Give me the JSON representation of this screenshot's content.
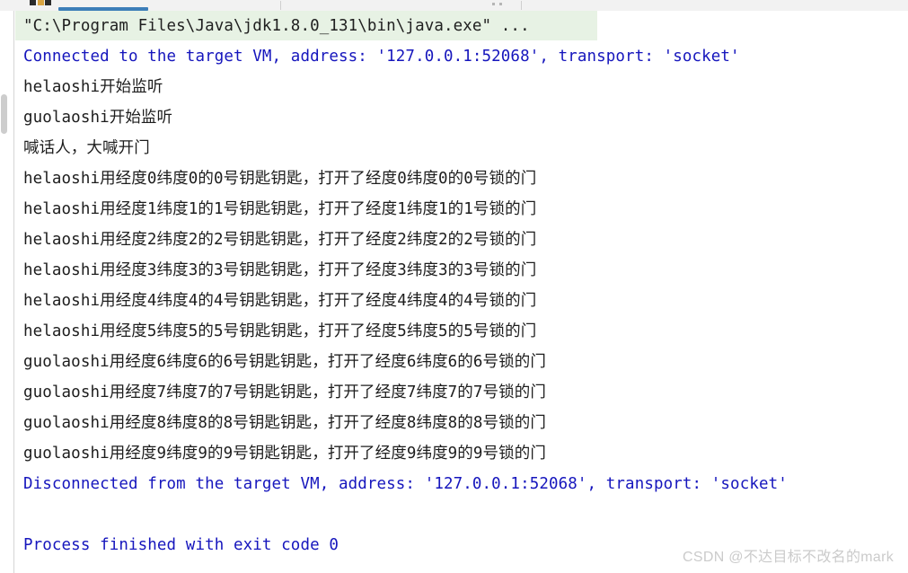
{
  "window": {
    "app": "IntelliJ IDEA Run Console",
    "accent_blue": "#3c7eb8",
    "vm_text_color": "#1616bd",
    "highlight_bg": "#e7f2e4"
  },
  "tab_strip": {
    "active_tab_indicator": "run-tab-underline",
    "separator": "|",
    "overflow_dots": "⋯"
  },
  "console": {
    "scrollbar": {
      "thumb_label": "vertical-scroll-thumb"
    },
    "lines": [
      {
        "id": "cmd",
        "kind": "cmd",
        "text": "\"C:\\Program Files\\Java\\jdk1.8.0_131\\bin\\java.exe\" ...",
        "highlighted": true
      },
      {
        "id": "connected",
        "kind": "vm",
        "text": "Connected to the target VM, address: '127.0.0.1:52068', transport: 'socket'",
        "highlighted": false
      },
      {
        "id": "out-1",
        "kind": "stdout",
        "text": "helaoshi开始监听",
        "highlighted": false
      },
      {
        "id": "out-2",
        "kind": "stdout",
        "text": "guolaoshi开始监听",
        "highlighted": false
      },
      {
        "id": "out-3",
        "kind": "stdout",
        "text": "喊话人，大喊开门",
        "highlighted": false
      },
      {
        "id": "out-4",
        "kind": "stdout",
        "text": "helaoshi用经度0纬度0的0号钥匙钥匙，打开了经度0纬度0的0号锁的门",
        "highlighted": false
      },
      {
        "id": "out-5",
        "kind": "stdout",
        "text": "helaoshi用经度1纬度1的1号钥匙钥匙，打开了经度1纬度1的1号锁的门",
        "highlighted": false
      },
      {
        "id": "out-6",
        "kind": "stdout",
        "text": "helaoshi用经度2纬度2的2号钥匙钥匙，打开了经度2纬度2的2号锁的门",
        "highlighted": false
      },
      {
        "id": "out-7",
        "kind": "stdout",
        "text": "helaoshi用经度3纬度3的3号钥匙钥匙，打开了经度3纬度3的3号锁的门",
        "highlighted": false
      },
      {
        "id": "out-8",
        "kind": "stdout",
        "text": "helaoshi用经度4纬度4的4号钥匙钥匙，打开了经度4纬度4的4号锁的门",
        "highlighted": false
      },
      {
        "id": "out-9",
        "kind": "stdout",
        "text": "helaoshi用经度5纬度5的5号钥匙钥匙，打开了经度5纬度5的5号锁的门",
        "highlighted": false
      },
      {
        "id": "out-10",
        "kind": "stdout",
        "text": "guolaoshi用经度6纬度6的6号钥匙钥匙，打开了经度6纬度6的6号锁的门",
        "highlighted": false
      },
      {
        "id": "out-11",
        "kind": "stdout",
        "text": "guolaoshi用经度7纬度7的7号钥匙钥匙，打开了经度7纬度7的7号锁的门",
        "highlighted": false
      },
      {
        "id": "out-12",
        "kind": "stdout",
        "text": "guolaoshi用经度8纬度8的8号钥匙钥匙，打开了经度8纬度8的8号锁的门",
        "highlighted": false
      },
      {
        "id": "out-13",
        "kind": "stdout",
        "text": "guolaoshi用经度9纬度9的9号钥匙钥匙，打开了经度9纬度9的9号锁的门",
        "highlighted": false
      },
      {
        "id": "disconnected",
        "kind": "vm",
        "text": "Disconnected from the target VM, address: '127.0.0.1:52068', transport: 'socket'",
        "highlighted": false
      },
      {
        "id": "spacer",
        "kind": "blank",
        "text": "",
        "highlighted": false
      },
      {
        "id": "exit",
        "kind": "vm",
        "text": "Process finished with exit code 0",
        "highlighted": false
      }
    ]
  },
  "watermark": {
    "text": "CSDN @不达目标不改名的mark"
  }
}
